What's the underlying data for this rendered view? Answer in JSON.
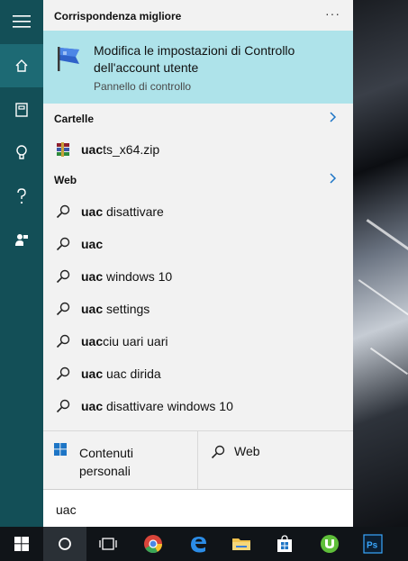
{
  "sidebar": {
    "items": [
      {
        "name": "hamburger-menu-icon"
      },
      {
        "name": "home-icon"
      },
      {
        "name": "notebook-icon"
      },
      {
        "name": "lightbulb-icon"
      },
      {
        "name": "help-icon"
      },
      {
        "name": "feedback-icon"
      }
    ]
  },
  "best_match": {
    "header": "Corrispondenza migliore",
    "more": "···",
    "title": "Modifica le impostazioni di Controllo dell'account utente",
    "subtitle": "Pannello di controllo"
  },
  "folders": {
    "header": "Cartelle",
    "items": [
      {
        "bold": "uac",
        "rest": "ts_x64.zip"
      }
    ]
  },
  "web": {
    "header": "Web",
    "items": [
      {
        "bold": "uac",
        "rest": " disattivare"
      },
      {
        "bold": "uac",
        "rest": ""
      },
      {
        "bold": "uac",
        "rest": " windows 10"
      },
      {
        "bold": "uac",
        "rest": " settings"
      },
      {
        "bold": "uac",
        "rest": "ciu uari uari"
      },
      {
        "bold": "uac",
        "rest": " uac dirida"
      },
      {
        "bold": "uac",
        "rest": " disattivare windows 10"
      }
    ]
  },
  "filters": {
    "personal": "Contenuti\npersonali",
    "web": "Web"
  },
  "search": {
    "value": "uac"
  },
  "colors": {
    "sidebar": "#134f57",
    "highlight": "#aee3ea",
    "accent": "#1d75c6"
  }
}
